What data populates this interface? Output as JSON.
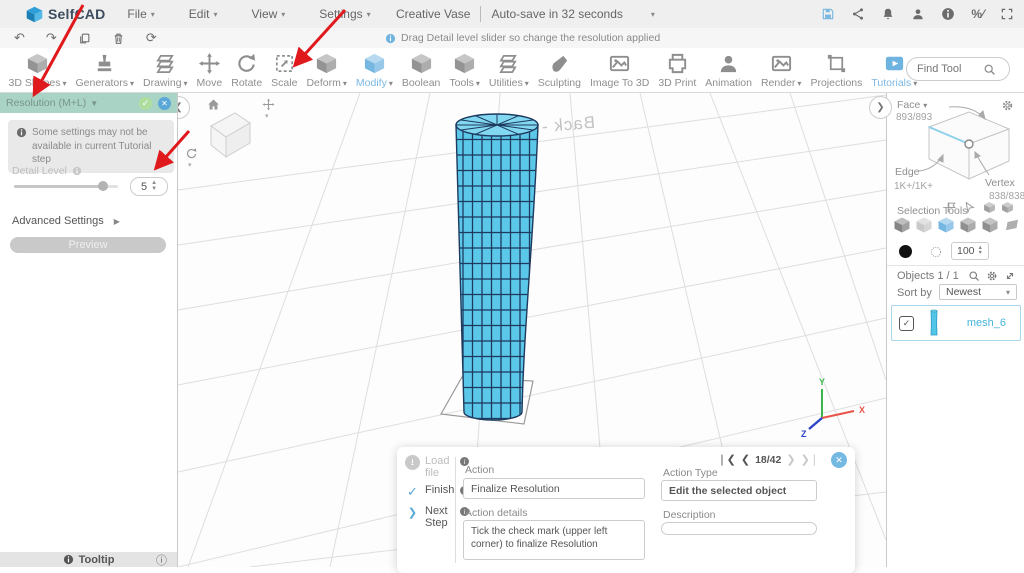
{
  "menubar": {
    "logo_text": "SelfCAD",
    "menus": [
      {
        "label": "File"
      },
      {
        "label": "Edit"
      },
      {
        "label": "View"
      },
      {
        "label": "Settings"
      }
    ],
    "project_name": "Creative Vase",
    "autosave_label": "Auto-save in 32 seconds",
    "right_icons": [
      "save-icon",
      "share-icon",
      "notifications-bell-icon",
      "user-icon",
      "info-icon",
      "shortcuts-icon",
      "fullscreen-icon"
    ]
  },
  "iconbar": {
    "icons": [
      "undo-icon",
      "redo-icon",
      "copy-icon",
      "delete-icon",
      "reload-icon"
    ],
    "notice": "Drag Detail level slider so change the resolution applied"
  },
  "toolbar": {
    "items": [
      {
        "label": "3D Shapes",
        "dropdown": true
      },
      {
        "label": "Generators",
        "dropdown": true
      },
      {
        "label": "Drawing",
        "dropdown": true
      },
      {
        "label": "Move"
      },
      {
        "label": "Rotate"
      },
      {
        "label": "Scale"
      },
      {
        "label": "Deform",
        "dropdown": true
      },
      {
        "label": "Modify",
        "dropdown": true,
        "active": true
      },
      {
        "label": "Boolean"
      },
      {
        "label": "Tools",
        "dropdown": true
      },
      {
        "label": "Utilities",
        "dropdown": true
      },
      {
        "label": "Sculpting"
      },
      {
        "label": "Image To 3D"
      },
      {
        "label": "3D Print"
      },
      {
        "label": "Animation"
      },
      {
        "label": "Render",
        "dropdown": true
      },
      {
        "label": "Projections"
      },
      {
        "label": "Tutorials",
        "dropdown": true,
        "active": true
      }
    ],
    "find_tool_placeholder": "Find Tool"
  },
  "left_panel": {
    "title": "Resolution (M+L)",
    "warning": "Some settings may not be available in current Tutorial step",
    "detail_level_label": "Detail Level",
    "detail_level_value": "5",
    "advanced_settings_label": "Advanced Settings",
    "preview_label": "Preview",
    "tooltip_label": "Tooltip"
  },
  "viewport": {
    "back_wall_label": "Back -",
    "axis": {
      "x": "X",
      "y": "Y",
      "z": "Z"
    },
    "vase_fill": "#5bc8e9",
    "vase_wireframe": "#1d3a5f"
  },
  "right_panel": {
    "face_label": "Face",
    "face_count": "893/893",
    "edge_label": "Edge",
    "edge_count": "1K+/1K+",
    "vertex_label": "Vertex",
    "vertex_count": "838/838",
    "selection_tools_label": "Selection Tools",
    "tolerance_value": "100",
    "objects_label": "Objects 1 / 1",
    "sort_by_label": "Sort by",
    "sort_value": "Newest",
    "objects": [
      {
        "name": "mesh_6",
        "checked": true
      }
    ]
  },
  "dialog": {
    "steps": [
      {
        "label": "Load file",
        "state": "disabled"
      },
      {
        "label": "Finish",
        "state": "done"
      },
      {
        "label": "Next Step",
        "state": "next"
      }
    ],
    "action_label": "Action",
    "action_value": "Finalize Resolution",
    "action_details_label": "Action details",
    "action_details_value": "Tick the check mark (upper left corner) to finalize Resolution",
    "action_type_label": "Action Type",
    "action_type_value": "Edit the selected object",
    "description_label": "Description",
    "description_value": "",
    "page": "18/42"
  },
  "colors": {
    "accent_blue": "#6fb3e0",
    "panel_header_teal": "#a9d3c5",
    "annotation_red": "#e0191c",
    "mesh_name_blue": "#47b6da"
  }
}
